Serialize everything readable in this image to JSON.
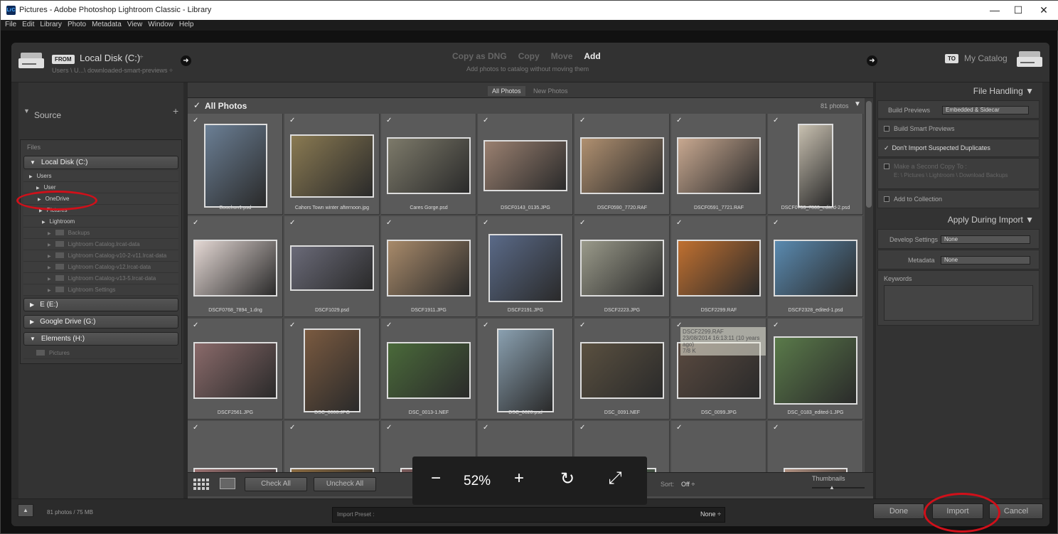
{
  "window": {
    "title": "Pictures - Adobe Photoshop Lightroom Classic - Library",
    "app_icon": "LrC",
    "min": "—",
    "max": "☐",
    "close": "✕"
  },
  "menu": [
    "File",
    "Edit",
    "Library",
    "Photo",
    "Metadata",
    "View",
    "Window",
    "Help"
  ],
  "topbar": {
    "from_tag": "FROM",
    "source_name": "Local Disk (C:)",
    "source_path": "Users \\ U...\\ downloaded-smart-previews ÷",
    "modes": [
      "Copy as DNG",
      "Copy",
      "Move",
      "Add"
    ],
    "mode_subtitle": "Add photos to catalog without moving them",
    "to_tag": "TO",
    "dest_name": "My Catalog"
  },
  "source": {
    "header": "Source",
    "plus": "+",
    "files_label": "Files",
    "volumes": [
      {
        "label": "Local Disk (C:)",
        "arrow": "▼"
      },
      {
        "label": "E (E:)",
        "arrow": "▶"
      },
      {
        "label": "Google Drive (G:)",
        "arrow": "▶"
      },
      {
        "label": "Elements (H:)",
        "arrow": "▼"
      }
    ],
    "folders": [
      {
        "label": "Users"
      },
      {
        "label": "User"
      },
      {
        "label": "OneDrive"
      },
      {
        "label": "Pictures"
      },
      {
        "label": "Lightroom"
      },
      {
        "label": "Backups"
      },
      {
        "label": "Lightroom Catalog.lrcat-data"
      },
      {
        "label": "Lightroom Catalog-v10-2-v11.lrcat-data"
      },
      {
        "label": "Lightroom Catalog-v12.lrcat-data"
      },
      {
        "label": "Lightroom Catalog-v13-5.lrcat-data"
      },
      {
        "label": "Lightroom Settings"
      }
    ],
    "elements_child": "Pictures"
  },
  "tabs": {
    "all": "All Photos",
    "new": "New Photos"
  },
  "grid": {
    "title": "All Photos",
    "count": "81 photos",
    "check": "✓",
    "photos": [
      {
        "name": "Bouchon1.psd",
        "c": "#6b7f95"
      },
      {
        "name": "Cahors Town winter afternoon.jpg",
        "c": "#8a7a52"
      },
      {
        "name": "Cares Gorge.psd",
        "c": "#7d7a6a"
      },
      {
        "name": "DSCF0143_0135.JPG",
        "c": "#9a8070"
      },
      {
        "name": "DSCF0590_7720.RAF",
        "c": "#b09070"
      },
      {
        "name": "DSCF0591_7721.RAF",
        "c": "#c8a890"
      },
      {
        "name": "DSCF0753_7863_edited-2.psd",
        "c": "#c8c0b0"
      },
      {
        "name": "DSCF0768_7894_1.dng",
        "c": "#e4d8d4"
      },
      {
        "name": "DSCF1029.psd",
        "c": "#6a6a78"
      },
      {
        "name": "DSCF1911.JPG",
        "c": "#a88a6a"
      },
      {
        "name": "DSCF2191.JPG",
        "c": "#5a6a88"
      },
      {
        "name": "DSCF2223.JPG",
        "c": "#9a9a8a"
      },
      {
        "name": "DSCF2299.RAF",
        "c": "#c07030"
      },
      {
        "name": "DSCF2328_edited-1.psd",
        "c": "#5a8ab0"
      },
      {
        "name": "DSCF2561.JPG",
        "c": "#8a6a6a"
      },
      {
        "name": "DSC_0008.JPG",
        "c": "#7a5a40"
      },
      {
        "name": "DSC_0013-1.NEF",
        "c": "#4a6a3a"
      },
      {
        "name": "DSC_0020.psd",
        "c": "#8aa0b0"
      },
      {
        "name": "DSC_0091.NEF",
        "c": "#5a5040"
      },
      {
        "name": "DSC_0099.JPG",
        "c": "#5a4a40"
      },
      {
        "name": "DSC_0183_edited-1.JPG",
        "c": "#5a7a4a"
      },
      {
        "name": "",
        "c": "#9a7070"
      },
      {
        "name": "",
        "c": "#8a6a40"
      },
      {
        "name": "",
        "c": "#7a5a5a"
      },
      {
        "name": "",
        "c": "#444"
      },
      {
        "name": "",
        "c": "#6a8a6a"
      },
      {
        "name": "",
        "c": "#aaa"
      },
      {
        "name": "",
        "c": "#b09080"
      }
    ]
  },
  "tooltip": {
    "line1": "DSCF2299.RAF",
    "line2": "23/08/2014 16:13:11 (10 years ago)",
    "line3": "7/8 K"
  },
  "bottom": {
    "grid_icon": "grid-view",
    "loupe_icon": "loupe-view",
    "check_all": "Check All",
    "uncheck_all": "Uncheck All",
    "sort_label": "Sort:",
    "sort_value": "Off ÷",
    "thumbs_label": "Thumbnails"
  },
  "zoom": {
    "minus": "−",
    "value": "52%",
    "plus": "+",
    "rotate": "↻",
    "fit": "⤢"
  },
  "right": {
    "file_handling": "File Handling",
    "build_previews_label": "Build Previews",
    "build_previews_value": "Embedded & Sidecar",
    "build_smart": "Build Smart Previews",
    "dont_import": "Don't Import Suspected Duplicates",
    "second_copy": "Make a Second Copy To :",
    "second_path": "E: \\ Pictures \\ Lightroom \\ Download Backups",
    "add_collection": "Add to Collection",
    "apply_header": "Apply During Import",
    "develop_label": "Develop Settings",
    "develop_value": "None",
    "metadata_label": "Metadata",
    "metadata_value": "None",
    "keywords_label": "Keywords"
  },
  "footer": {
    "up": "▲",
    "stats": "81 photos / 75 MB",
    "preset_label": "Import Preset :",
    "preset_value": "None ÷",
    "done": "Done",
    "import": "Import",
    "cancel": "Cancel"
  },
  "colors": {
    "accent_circle": "#d0101a"
  }
}
